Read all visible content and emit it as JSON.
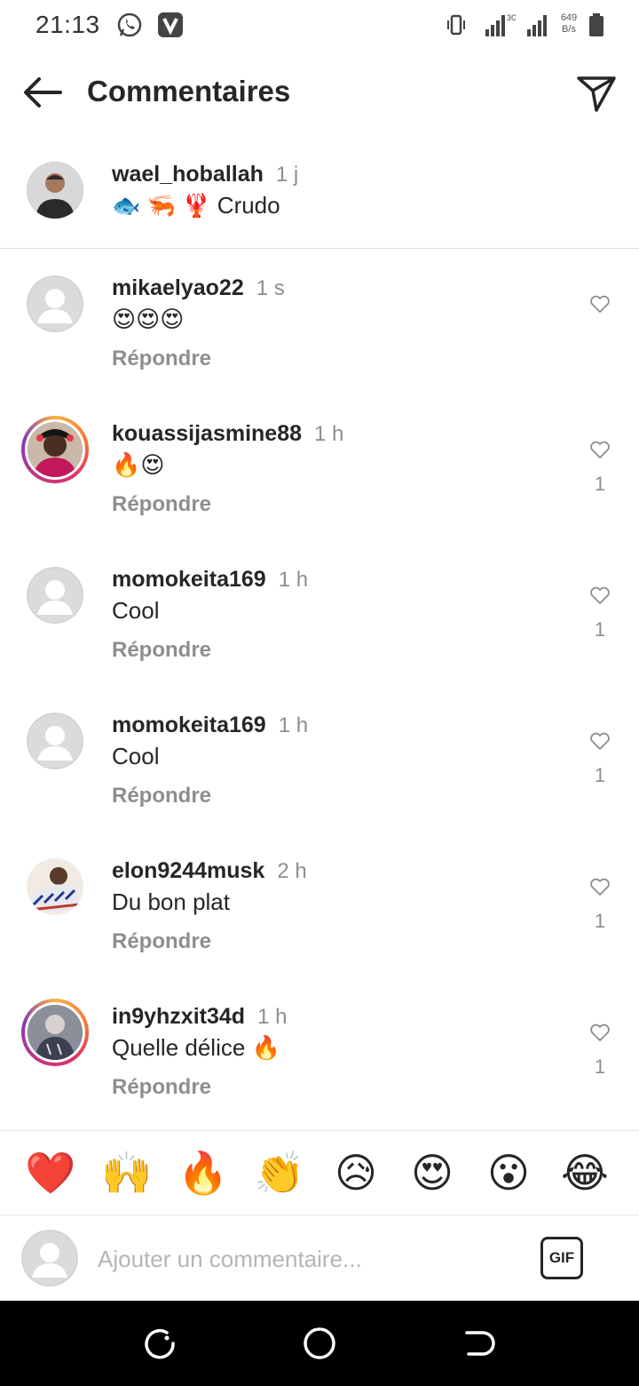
{
  "status_bar": {
    "time": "21:13",
    "network_type": "3G",
    "speed_value": "649",
    "speed_unit": "B/s"
  },
  "header": {
    "title": "Commentaires"
  },
  "caption": {
    "username": "wael_hoballah",
    "time": "1 j",
    "text": "🐟 🦐 🦞 Crudo"
  },
  "comments": [
    {
      "username": "mikaelyao22",
      "time": "1 s",
      "text": "😍😍😍",
      "reply_label": "Répondre",
      "likes": ""
    },
    {
      "username": "kouassijasmine88",
      "time": "1 h",
      "text": "🔥😍",
      "reply_label": "Répondre",
      "likes": "1"
    },
    {
      "username": "momokeita169",
      "time": "1 h",
      "text": "Cool",
      "reply_label": "Répondre",
      "likes": "1"
    },
    {
      "username": "momokeita169",
      "time": "1 h",
      "text": "Cool",
      "reply_label": "Répondre",
      "likes": "1"
    },
    {
      "username": "elon9244musk",
      "time": "2 h",
      "text": "Du bon plat",
      "reply_label": "Répondre",
      "likes": "1"
    },
    {
      "username": "in9yhzxit34d",
      "time": "1 h",
      "text": "Quelle délice 🔥",
      "reply_label": "Répondre",
      "likes": "1"
    }
  ],
  "reactions": [
    "❤️",
    "🙌",
    "🔥",
    "👏",
    "😥",
    "😍",
    "😮",
    "😂"
  ],
  "comment_input": {
    "placeholder": "Ajouter un commentaire...",
    "gif_label": "GIF"
  },
  "colors": {
    "text": "#262626",
    "secondary": "#8e8e8e",
    "divider": "#dbdbdb",
    "nav_bg": "#000000"
  }
}
